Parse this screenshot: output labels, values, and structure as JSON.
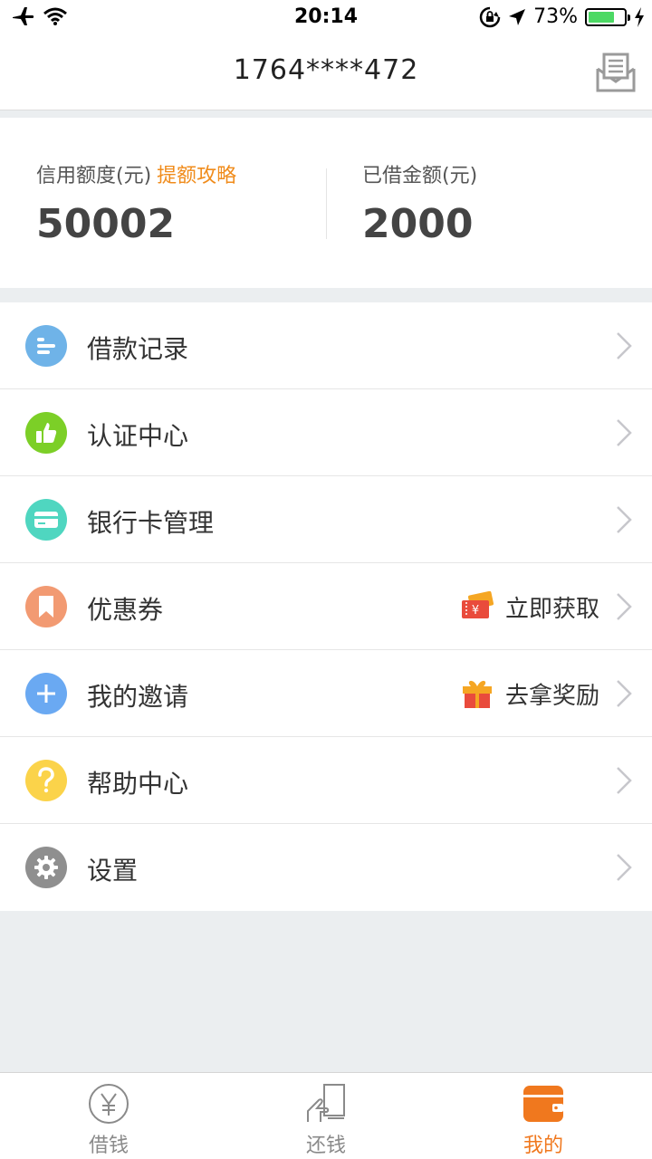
{
  "status_bar": {
    "time": "20:14",
    "battery": "73%"
  },
  "header": {
    "title": "1764****472"
  },
  "summary": {
    "credit_label": "信用额度(元)",
    "credit_link": "提额攻略",
    "credit_value": "50002",
    "borrowed_label": "已借金额(元)",
    "borrowed_value": "2000"
  },
  "menu": [
    {
      "label": "借款记录",
      "icon": "record-icon",
      "color": "#6fb3e8"
    },
    {
      "label": "认证中心",
      "icon": "thumbs-up-icon",
      "color": "#7ccf27"
    },
    {
      "label": "银行卡管理",
      "icon": "card-icon",
      "color": "#4fd6c0"
    },
    {
      "label": "优惠券",
      "icon": "bookmark-icon",
      "color": "#f29a72",
      "extra": "立即获取"
    },
    {
      "label": "我的邀请",
      "icon": "plus-icon",
      "color": "#6aa9f2",
      "extra": "去拿奖励"
    },
    {
      "label": "帮助中心",
      "icon": "question-icon",
      "color": "#fbd34a"
    },
    {
      "label": "设置",
      "icon": "gear-icon",
      "color": "#8f8f8f"
    }
  ],
  "tabbar": {
    "tabs": [
      {
        "label": "借钱"
      },
      {
        "label": "还钱"
      },
      {
        "label": "我的"
      }
    ],
    "active_color": "#f0781e"
  }
}
